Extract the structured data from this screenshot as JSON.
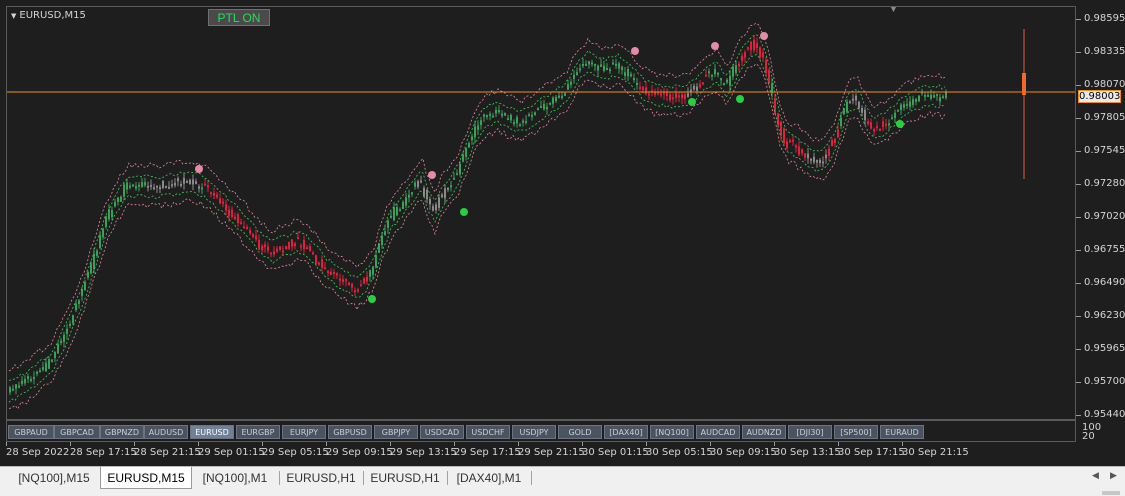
{
  "chart": {
    "title": "EURUSD,M15",
    "indicator_button": "PTL ON",
    "current_price": "0.98003",
    "hidden_price": "0.98070",
    "colors": {
      "background": "#1e1e1e",
      "bull": "#3aa05a",
      "bear": "#e0203c",
      "neutral": "#8a8a8a",
      "upper_band": "#e88aa6",
      "lower_band": "#3fcf5a",
      "current_price_line": "#f28c1c",
      "signal_top": "#e58aa8",
      "signal_bottom": "#28d040"
    },
    "price_axis": [
      "0.98595",
      "0.98335",
      "0.98070",
      "0.97805",
      "0.97545",
      "0.97280",
      "0.97020",
      "0.96755",
      "0.96490",
      "0.96230",
      "0.95965",
      "0.95700",
      "0.95440"
    ],
    "time_axis": [
      "28 Sep 2022",
      "28 Sep 17:15",
      "28 Sep 21:15",
      "29 Sep 01:15",
      "29 Sep 05:15",
      "29 Sep 09:15",
      "29 Sep 13:15",
      "29 Sep 17:15",
      "29 Sep 21:15",
      "30 Sep 01:15",
      "30 Sep 05:15",
      "30 Sep 09:15",
      "30 Sep 13:15",
      "30 Sep 17:15",
      "30 Sep 21:15"
    ],
    "indicator_axis": [
      "100",
      "20"
    ]
  },
  "symbol_buttons": [
    "GBPAUD",
    "GBPCAD",
    "GBPNZD",
    "AUDUSD",
    "EURUSD",
    "EURGBP",
    "EURJPY",
    "GBPUSD",
    "GBPJPY",
    "USDCAD",
    "USDCHF",
    "USDJPY",
    "GOLD",
    "[DAX40]",
    "[NQ100]",
    "AUDCAD",
    "AUDNZD",
    "[DJI30]",
    "[SP500]",
    "EURAUD"
  ],
  "active_symbol": "EURUSD",
  "tabs": [
    "[NQ100],M15",
    "EURUSD,M15",
    "[NQ100],M1",
    "EURUSD,H1",
    "EURUSD,H1",
    "[DAX40],M1"
  ],
  "active_tab": 1,
  "icons": {
    "chart_menu": "triangle-down-icon",
    "scroll_left": "scroll-left-icon",
    "scroll_right": "scroll-right-icon"
  }
}
